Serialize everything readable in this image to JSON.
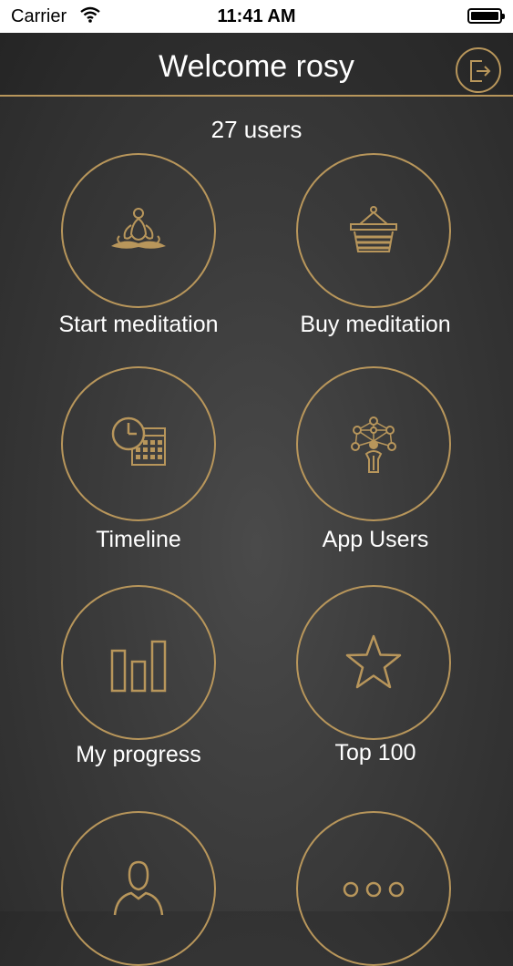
{
  "status_bar": {
    "carrier": "Carrier",
    "time": "11:41 AM"
  },
  "header": {
    "title": "Welcome rosy",
    "logout_icon": "logout-icon"
  },
  "user_count": "27 users",
  "menu": {
    "start_meditation": "Start meditation",
    "buy_meditation": "Buy meditation",
    "timeline": "Timeline",
    "app_users": "App Users",
    "my_progress": "My progress",
    "top_100": "Top 100"
  },
  "colors": {
    "accent": "#b8965b",
    "background": "#3a3a3a",
    "text": "#ffffff"
  }
}
